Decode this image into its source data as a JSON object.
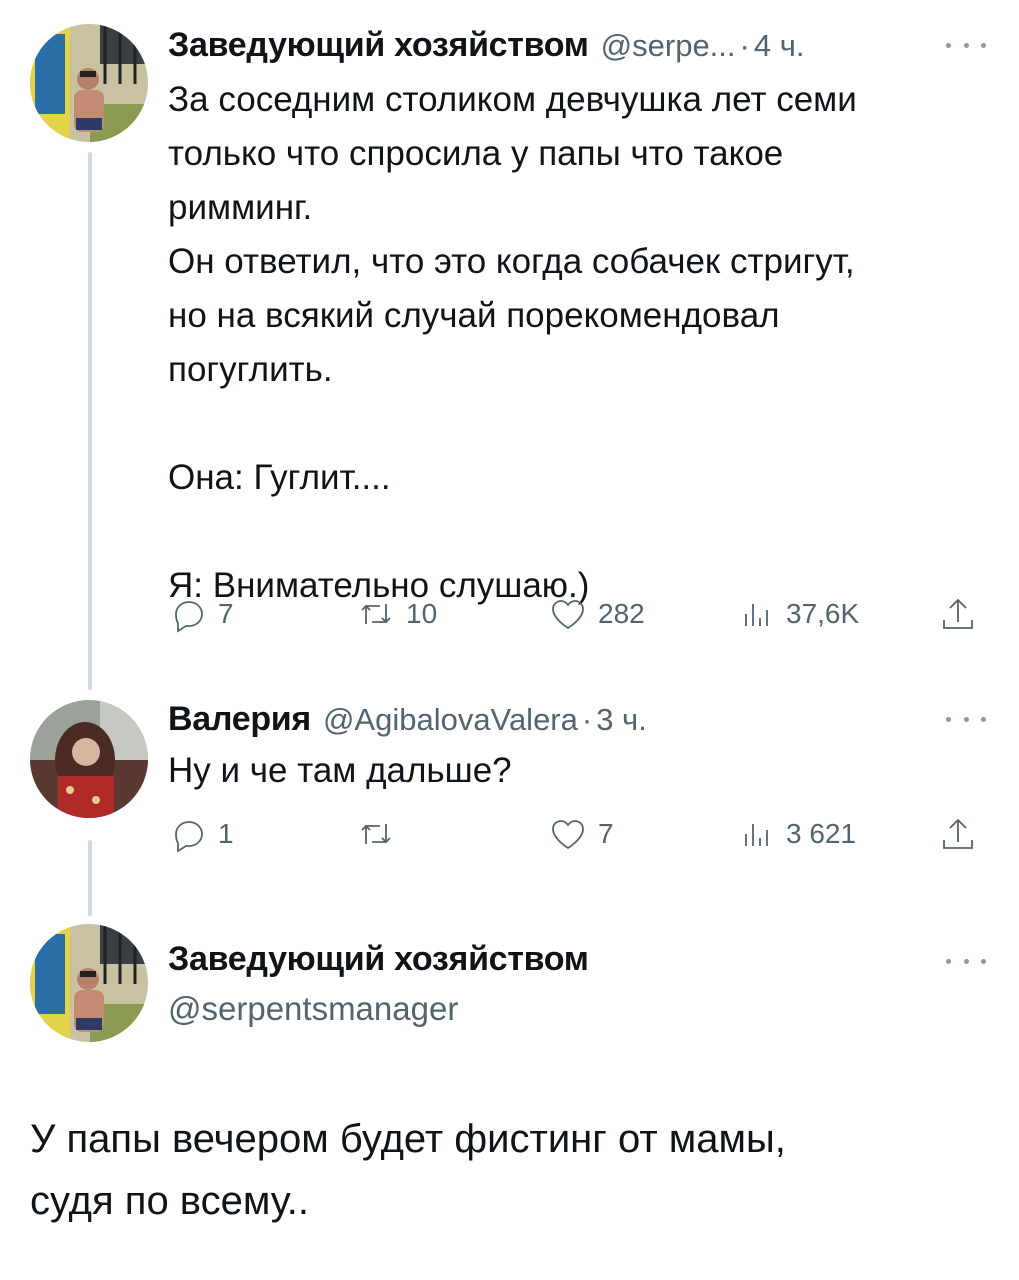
{
  "tweet1": {
    "author": "Заведующий хозяйством",
    "handle": "@serpe...",
    "separator": "·",
    "time": "4 ч.",
    "text": "За соседним столиком девчушка лет семи\nтолько что спросила у папы что такое\nримминг.\nОн ответил, что это когда собачек стригут,\nно на всякий случай порекомендовал\nпогуглить.\n\nОна: Гуглит....\n\nЯ: Внимательно слушаю.)",
    "replies": "7",
    "retweets": "10",
    "likes": "282",
    "views": "37,6K"
  },
  "tweet2": {
    "author": "Валерия",
    "handle": "@AgibalovaValera",
    "separator": "·",
    "time": "3 ч.",
    "text": "Ну и че там дальше?",
    "replies": "1",
    "retweets": "",
    "likes": "7",
    "views": "3 621"
  },
  "tweet3": {
    "author": "Заведующий хозяйством",
    "handle": "@serpentsmanager",
    "text": "У папы вечером будет фистинг от мамы,\nсудя по всему.."
  },
  "icons": {
    "reply": "reply-icon",
    "retweet": "retweet-icon",
    "like": "heart-icon",
    "views": "views-icon",
    "share": "share-icon",
    "more": "more-icon"
  }
}
